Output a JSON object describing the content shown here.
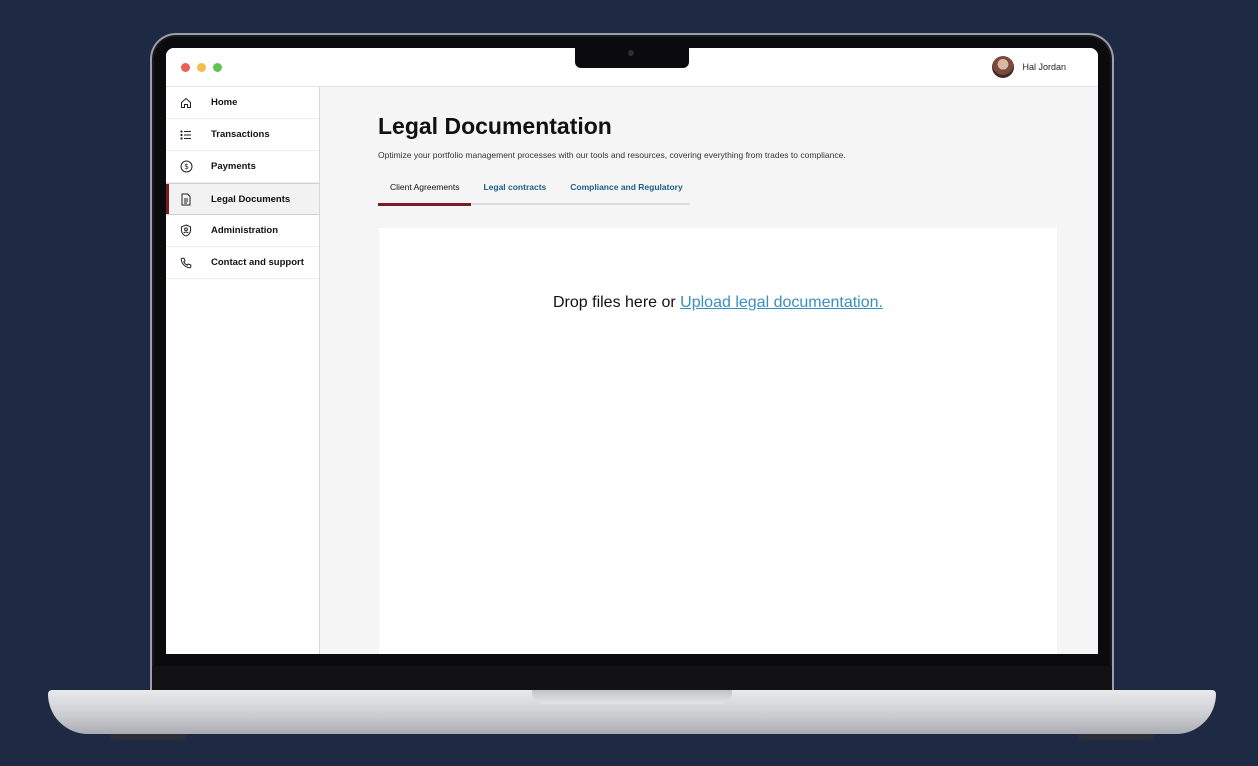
{
  "window": {
    "controls": [
      "close",
      "minimize",
      "maximize"
    ]
  },
  "user": {
    "name": "Hal Jordan"
  },
  "sidebar": {
    "items": [
      {
        "label": "Home",
        "icon": "home-icon"
      },
      {
        "label": "Transactions",
        "icon": "list-icon"
      },
      {
        "label": "Payments",
        "icon": "dollar-circle-icon"
      },
      {
        "label": "Legal Documents",
        "icon": "document-icon",
        "active": true
      },
      {
        "label": "Administration",
        "icon": "shield-user-icon"
      },
      {
        "label": "Contact and support",
        "icon": "phone-icon"
      }
    ]
  },
  "main": {
    "title": "Legal Documentation",
    "subtitle": "Optimize your portfolio management processes with our tools and resources, covering everything from trades to compliance.",
    "tabs": [
      {
        "label": "Client Agreements",
        "active": true
      },
      {
        "label": "Legal contracts"
      },
      {
        "label": "Compliance and Regulatory"
      }
    ],
    "dropzone": {
      "text": "Drop files here or ",
      "link": "Upload legal documentation."
    }
  },
  "colors": {
    "accent": "#7d1a23",
    "link": "#3a8fc2",
    "tab_link": "#1b5e8a",
    "backdrop": "#1e2a44"
  }
}
